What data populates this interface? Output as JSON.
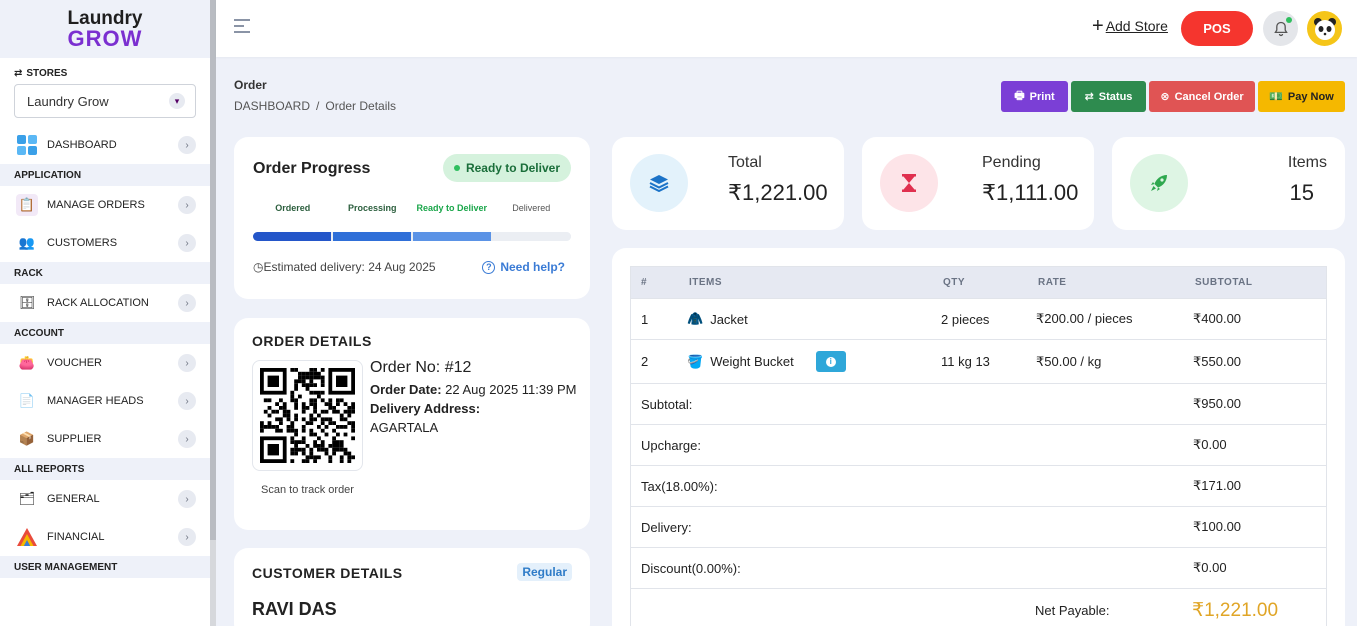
{
  "brand": {
    "line1": "Laundry",
    "line2": "GROW"
  },
  "sidebar": {
    "stores_label": "STORES",
    "store_selected": "Laundry Grow",
    "sections": {
      "application": "APPLICATION",
      "rack": "RACK",
      "account": "ACCOUNT",
      "all_reports": "ALL REPORTS",
      "user_management": "USER MANAGEMENT"
    },
    "items": {
      "dashboard": "DASHBOARD",
      "manage_orders": "MANAGE ORDERS",
      "customers": "CUSTOMERS",
      "rack_allocation": "RACK ALLOCATION",
      "voucher": "VOUCHER",
      "manager_heads": "MANAGER HEADS",
      "supplier": "SUPPLIER",
      "general": "GENERAL",
      "financial": "FINANCIAL"
    }
  },
  "topbar": {
    "add_store": "Add Store",
    "pos": "POS"
  },
  "page": {
    "title": "Order",
    "breadcrumb_root": "DASHBOARD",
    "breadcrumb_sep": "/",
    "breadcrumb_current": "Order Details"
  },
  "actions": {
    "print": "Print",
    "status": "Status",
    "cancel": "Cancel Order",
    "pay": "Pay Now"
  },
  "progress": {
    "title": "Order Progress",
    "badge": "Ready to Deliver",
    "steps": [
      "Ordered",
      "Processing",
      "Ready to Deliver",
      "Delivered"
    ],
    "completed_steps": 3,
    "estimated": "Estimated delivery: 24 Aug 2025",
    "help": "Need help?"
  },
  "order_details": {
    "title": "ORDER DETAILS",
    "order_no": "Order No: #12",
    "order_date_label": "Order Date:",
    "order_date": "22 Aug 2025 11:39 PM",
    "address_label": "Delivery Address:",
    "address": "AGARTALA",
    "qr_caption": "Scan to track order"
  },
  "customer": {
    "title": "CUSTOMER DETAILS",
    "badge": "Regular",
    "name": "RAVI DAS"
  },
  "stats": {
    "total": {
      "label": "Total",
      "value": "₹1,221.00"
    },
    "pending": {
      "label": "Pending",
      "value": "₹1,111.00"
    },
    "items": {
      "label": "Items",
      "value": "15"
    }
  },
  "table": {
    "headers": {
      "num": "#",
      "items": "ITEMS",
      "qty": "QTY",
      "rate": "RATE",
      "subtotal": "SUBTOTAL"
    },
    "rows": [
      {
        "num": "1",
        "item": "Jacket",
        "qty": "2 pieces",
        "rate": "₹200.00 / pieces",
        "subtotal": "₹400.00"
      },
      {
        "num": "2",
        "item": "Weight Bucket",
        "qty": "11 kg 13",
        "rate": "₹50.00 / kg",
        "subtotal": "₹550.00"
      }
    ],
    "summary": [
      {
        "label": "Subtotal:",
        "value": "₹950.00"
      },
      {
        "label": "Upcharge:",
        "value": "₹0.00"
      },
      {
        "label": "Tax(18.00%):",
        "value": "₹171.00"
      },
      {
        "label": "Delivery:",
        "value": "₹100.00"
      },
      {
        "label": "Discount(0.00%):",
        "value": "₹0.00"
      }
    ],
    "net_label": "Net Payable:",
    "net_value": "₹1,221.00"
  },
  "colors": {
    "accent_purple": "#7b3fd6",
    "pos_red": "#f5352e",
    "status_green": "#2e8b4f",
    "cancel_red": "#e05454",
    "pay_yellow": "#f5b800",
    "progress_blue": "#2456c9",
    "net_gold": "#e0a526"
  }
}
